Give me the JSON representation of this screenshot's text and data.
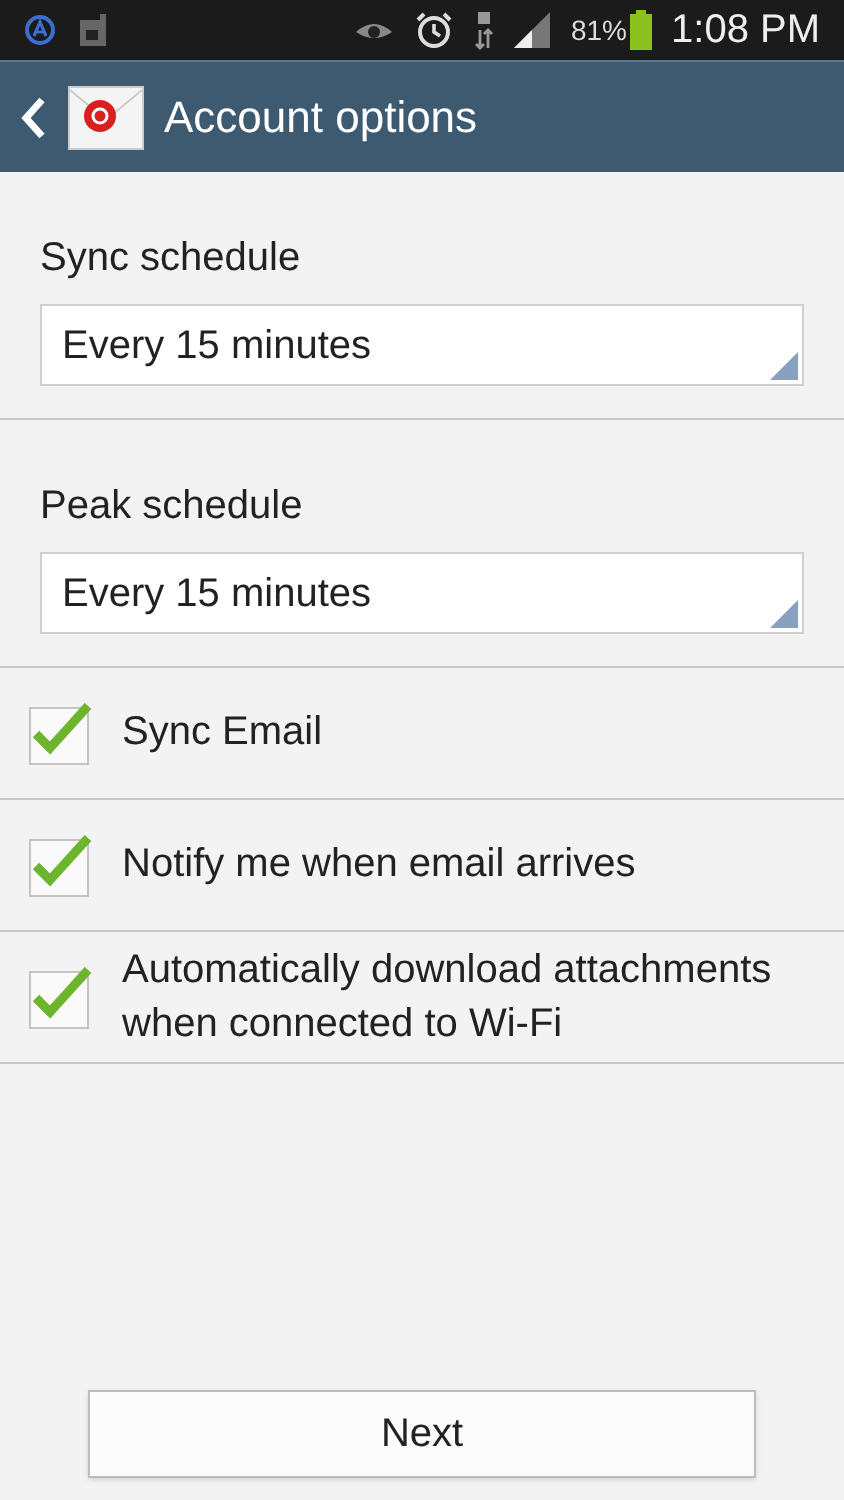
{
  "status_bar": {
    "battery_percent": "81%",
    "time": "1:08 PM"
  },
  "header": {
    "title": "Account options"
  },
  "schedules": [
    {
      "label": "Sync schedule",
      "value": "Every 15 minutes"
    },
    {
      "label": "Peak schedule",
      "value": "Every 15 minutes"
    }
  ],
  "options": [
    {
      "label": "Sync Email",
      "checked": true
    },
    {
      "label": "Notify me when email arrives",
      "checked": true
    },
    {
      "label": "Automatically download attachments when connected to Wi-Fi",
      "checked": true
    }
  ],
  "buttons": {
    "next": "Next"
  }
}
